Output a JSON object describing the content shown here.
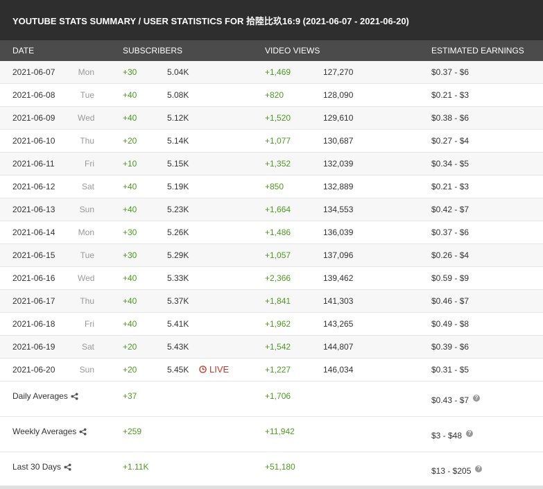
{
  "title": "YOUTUBE STATS SUMMARY / USER STATISTICS FOR 拾陸比玖16:9 (2021-06-07 - 2021-06-20)",
  "headers": {
    "date": "DATE",
    "subscribers": "SUBSCRIBERS",
    "video_views": "VIDEO VIEWS",
    "estimated_earnings": "ESTIMATED EARNINGS"
  },
  "rows": [
    {
      "date": "2021-06-07",
      "day": "Mon",
      "sub_delta": "+30",
      "sub_total": "5.04K",
      "views_delta": "+1,469",
      "views_total": "127,270",
      "earnings": "$0.37  -  $6",
      "live": ""
    },
    {
      "date": "2021-06-08",
      "day": "Tue",
      "sub_delta": "+40",
      "sub_total": "5.08K",
      "views_delta": "+820",
      "views_total": "128,090",
      "earnings": "$0.21  -  $3",
      "live": ""
    },
    {
      "date": "2021-06-09",
      "day": "Wed",
      "sub_delta": "+40",
      "sub_total": "5.12K",
      "views_delta": "+1,520",
      "views_total": "129,610",
      "earnings": "$0.38  -  $6",
      "live": ""
    },
    {
      "date": "2021-06-10",
      "day": "Thu",
      "sub_delta": "+20",
      "sub_total": "5.14K",
      "views_delta": "+1,077",
      "views_total": "130,687",
      "earnings": "$0.27  -  $4",
      "live": ""
    },
    {
      "date": "2021-06-11",
      "day": "Fri",
      "sub_delta": "+10",
      "sub_total": "5.15K",
      "views_delta": "+1,352",
      "views_total": "132,039",
      "earnings": "$0.34  -  $5",
      "live": ""
    },
    {
      "date": "2021-06-12",
      "day": "Sat",
      "sub_delta": "+40",
      "sub_total": "5.19K",
      "views_delta": "+850",
      "views_total": "132,889",
      "earnings": "$0.21  -  $3",
      "live": ""
    },
    {
      "date": "2021-06-13",
      "day": "Sun",
      "sub_delta": "+40",
      "sub_total": "5.23K",
      "views_delta": "+1,664",
      "views_total": "134,553",
      "earnings": "$0.42  -  $7",
      "live": ""
    },
    {
      "date": "2021-06-14",
      "day": "Mon",
      "sub_delta": "+30",
      "sub_total": "5.26K",
      "views_delta": "+1,486",
      "views_total": "136,039",
      "earnings": "$0.37  -  $6",
      "live": ""
    },
    {
      "date": "2021-06-15",
      "day": "Tue",
      "sub_delta": "+30",
      "sub_total": "5.29K",
      "views_delta": "+1,057",
      "views_total": "137,096",
      "earnings": "$0.26  -  $4",
      "live": ""
    },
    {
      "date": "2021-06-16",
      "day": "Wed",
      "sub_delta": "+40",
      "sub_total": "5.33K",
      "views_delta": "+2,366",
      "views_total": "139,462",
      "earnings": "$0.59  -  $9",
      "live": ""
    },
    {
      "date": "2021-06-17",
      "day": "Thu",
      "sub_delta": "+40",
      "sub_total": "5.37K",
      "views_delta": "+1,841",
      "views_total": "141,303",
      "earnings": "$0.46  -  $7",
      "live": ""
    },
    {
      "date": "2021-06-18",
      "day": "Fri",
      "sub_delta": "+40",
      "sub_total": "5.41K",
      "views_delta": "+1,962",
      "views_total": "143,265",
      "earnings": "$0.49  -  $8",
      "live": ""
    },
    {
      "date": "2021-06-19",
      "day": "Sat",
      "sub_delta": "+20",
      "sub_total": "5.43K",
      "views_delta": "+1,542",
      "views_total": "144,807",
      "earnings": "$0.39  -  $6",
      "live": ""
    },
    {
      "date": "2021-06-20",
      "day": "Sun",
      "sub_delta": "+20",
      "sub_total": "5.45K",
      "views_delta": "+1,227",
      "views_total": "146,034",
      "earnings": "$0.31  -  $5",
      "live": "LIVE"
    }
  ],
  "summary": [
    {
      "label": "Daily Averages",
      "subscribers": "+37",
      "views": "+1,706",
      "earnings": "$0.43  -  $7"
    },
    {
      "label": "Weekly Averages",
      "subscribers": "+259",
      "views": "+11,942",
      "earnings": "$3  -  $48"
    },
    {
      "label": "Last 30 Days",
      "subscribers": "+1.11K",
      "views": "+51,180",
      "earnings": "$13  -  $205"
    }
  ],
  "colors": {
    "positive": "#4b9a1e",
    "live": "#c0392b",
    "title_bg": "#2e2e2e",
    "header_bg": "#4b4b4b"
  },
  "icons": {
    "share": "share-icon",
    "help": "help-icon",
    "live": "clock-icon"
  }
}
